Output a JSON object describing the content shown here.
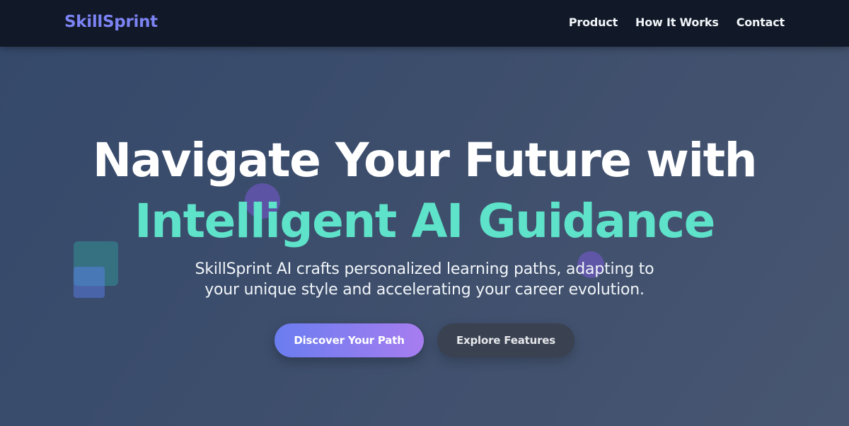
{
  "header": {
    "logo": "SkillSprint",
    "nav": [
      {
        "label": "Product"
      },
      {
        "label": "How It Works"
      },
      {
        "label": "Contact"
      }
    ]
  },
  "hero": {
    "headline_line1": "Navigate Your Future with",
    "headline_line2": "Intelligent AI Guidance",
    "subtitle": "SkillSprint AI crafts personalized learning paths, adapting to your unique style and accelerating your career evolution.",
    "primary_cta": "Discover Your Path",
    "secondary_cta": "Explore Features"
  },
  "colors": {
    "brand": "#7c83f3",
    "accent": "#5ee2c9",
    "nav_bg": "#111827",
    "cta_gradient_start": "#6a7df0",
    "cta_gradient_end": "#a77df0"
  }
}
